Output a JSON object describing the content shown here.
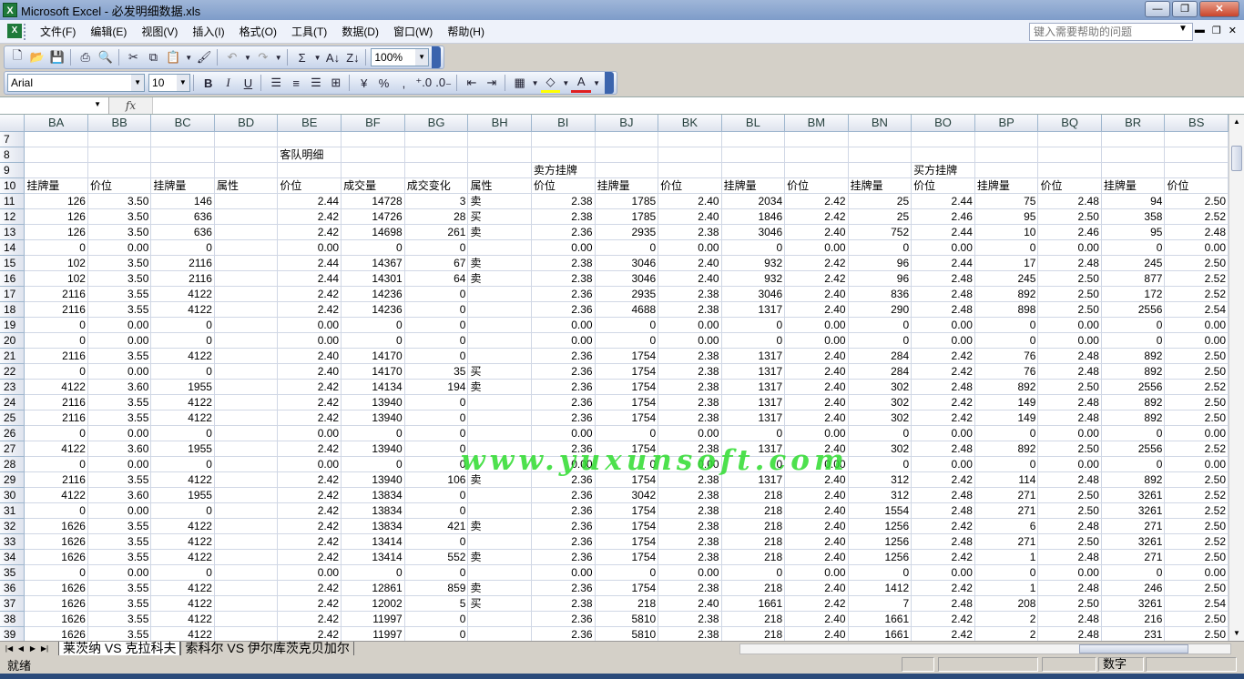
{
  "window": {
    "title": "Microsoft Excel - 必发明细数据.xls",
    "minimize": "—",
    "maximize": "❐",
    "close": "✕"
  },
  "menu": [
    "文件(F)",
    "编辑(E)",
    "视图(V)",
    "插入(I)",
    "格式(O)",
    "工具(T)",
    "数据(D)",
    "窗口(W)",
    "帮助(H)"
  ],
  "help_placeholder": "键入需要帮助的问题",
  "toolbar": {
    "zoom": "100%",
    "font": "Arial",
    "size": "10",
    "bold": "B",
    "italic": "I",
    "underline": "U",
    "sum": "Σ",
    "percent": "%"
  },
  "formula": {
    "fx": "fx",
    "name": "",
    "content": ""
  },
  "columns": [
    "BA",
    "BB",
    "BC",
    "BD",
    "BE",
    "BF",
    "BG",
    "BH",
    "BI",
    "BJ",
    "BK",
    "BL",
    "BM",
    "BN",
    "BO",
    "BP",
    "BQ",
    "BR",
    "BS"
  ],
  "rows": [
    {
      "n": "7",
      "c": [
        "",
        "",
        "",
        "",
        "",
        "",
        "",
        "",
        "",
        "",
        "",
        "",
        "",
        "",
        "",
        "",
        "",
        "",
        ""
      ]
    },
    {
      "n": "8",
      "c": [
        "",
        "",
        "",
        "",
        "客队明细",
        "",
        "",
        "",
        "",
        "",
        "",
        "",
        "",
        "",
        "",
        "",
        "",
        "",
        ""
      ]
    },
    {
      "n": "9",
      "c": [
        "",
        "",
        "",
        "",
        "",
        "",
        "",
        "",
        "卖方挂牌",
        "",
        "",
        "",
        "",
        "",
        "买方挂牌",
        "",
        "",
        "",
        ""
      ]
    },
    {
      "n": "10",
      "c": [
        "挂牌量",
        "价位",
        "挂牌量",
        "属性",
        "价位",
        "成交量",
        "成交变化",
        "属性",
        "价位",
        "挂牌量",
        "价位",
        "挂牌量",
        "价位",
        "挂牌量",
        "价位",
        "挂牌量",
        "价位",
        "挂牌量",
        "价位"
      ]
    },
    {
      "n": "11",
      "c": [
        "126",
        "3.50",
        "146",
        "",
        "2.44",
        "14728",
        "3",
        "卖",
        "2.38",
        "1785",
        "2.40",
        "2034",
        "2.42",
        "25",
        "2.44",
        "75",
        "2.48",
        "94",
        "2.50"
      ]
    },
    {
      "n": "12",
      "c": [
        "126",
        "3.50",
        "636",
        "",
        "2.42",
        "14726",
        "28",
        "买",
        "2.38",
        "1785",
        "2.40",
        "1846",
        "2.42",
        "25",
        "2.46",
        "95",
        "2.50",
        "358",
        "2.52"
      ]
    },
    {
      "n": "13",
      "c": [
        "126",
        "3.50",
        "636",
        "",
        "2.42",
        "14698",
        "261",
        "卖",
        "2.36",
        "2935",
        "2.38",
        "3046",
        "2.40",
        "752",
        "2.44",
        "10",
        "2.46",
        "95",
        "2.48"
      ]
    },
    {
      "n": "14",
      "c": [
        "0",
        "0.00",
        "0",
        "",
        "0.00",
        "0",
        "0",
        "",
        "0.00",
        "0",
        "0.00",
        "0",
        "0.00",
        "0",
        "0.00",
        "0",
        "0.00",
        "0",
        "0.00"
      ]
    },
    {
      "n": "15",
      "c": [
        "102",
        "3.50",
        "2116",
        "",
        "2.44",
        "14367",
        "67",
        "卖",
        "2.38",
        "3046",
        "2.40",
        "932",
        "2.42",
        "96",
        "2.44",
        "17",
        "2.48",
        "245",
        "2.50"
      ]
    },
    {
      "n": "16",
      "c": [
        "102",
        "3.50",
        "2116",
        "",
        "2.44",
        "14301",
        "64",
        "卖",
        "2.38",
        "3046",
        "2.40",
        "932",
        "2.42",
        "96",
        "2.48",
        "245",
        "2.50",
        "877",
        "2.52"
      ]
    },
    {
      "n": "17",
      "c": [
        "2116",
        "3.55",
        "4122",
        "",
        "2.42",
        "14236",
        "0",
        "",
        "2.36",
        "2935",
        "2.38",
        "3046",
        "2.40",
        "836",
        "2.48",
        "892",
        "2.50",
        "172",
        "2.52"
      ]
    },
    {
      "n": "18",
      "c": [
        "2116",
        "3.55",
        "4122",
        "",
        "2.42",
        "14236",
        "0",
        "",
        "2.36",
        "4688",
        "2.38",
        "1317",
        "2.40",
        "290",
        "2.48",
        "898",
        "2.50",
        "2556",
        "2.54"
      ]
    },
    {
      "n": "19",
      "c": [
        "0",
        "0.00",
        "0",
        "",
        "0.00",
        "0",
        "0",
        "",
        "0.00",
        "0",
        "0.00",
        "0",
        "0.00",
        "0",
        "0.00",
        "0",
        "0.00",
        "0",
        "0.00"
      ]
    },
    {
      "n": "20",
      "c": [
        "0",
        "0.00",
        "0",
        "",
        "0.00",
        "0",
        "0",
        "",
        "0.00",
        "0",
        "0.00",
        "0",
        "0.00",
        "0",
        "0.00",
        "0",
        "0.00",
        "0",
        "0.00"
      ]
    },
    {
      "n": "21",
      "c": [
        "2116",
        "3.55",
        "4122",
        "",
        "2.40",
        "14170",
        "0",
        "",
        "2.36",
        "1754",
        "2.38",
        "1317",
        "2.40",
        "284",
        "2.42",
        "76",
        "2.48",
        "892",
        "2.50"
      ]
    },
    {
      "n": "22",
      "c": [
        "0",
        "0.00",
        "0",
        "",
        "2.40",
        "14170",
        "35",
        "买",
        "2.36",
        "1754",
        "2.38",
        "1317",
        "2.40",
        "284",
        "2.42",
        "76",
        "2.48",
        "892",
        "2.50"
      ]
    },
    {
      "n": "23",
      "c": [
        "4122",
        "3.60",
        "1955",
        "",
        "2.42",
        "14134",
        "194",
        "卖",
        "2.36",
        "1754",
        "2.38",
        "1317",
        "2.40",
        "302",
        "2.48",
        "892",
        "2.50",
        "2556",
        "2.52"
      ]
    },
    {
      "n": "24",
      "c": [
        "2116",
        "3.55",
        "4122",
        "",
        "2.42",
        "13940",
        "0",
        "",
        "2.36",
        "1754",
        "2.38",
        "1317",
        "2.40",
        "302",
        "2.42",
        "149",
        "2.48",
        "892",
        "2.50"
      ]
    },
    {
      "n": "25",
      "c": [
        "2116",
        "3.55",
        "4122",
        "",
        "2.42",
        "13940",
        "0",
        "",
        "2.36",
        "1754",
        "2.38",
        "1317",
        "2.40",
        "302",
        "2.42",
        "149",
        "2.48",
        "892",
        "2.50"
      ]
    },
    {
      "n": "26",
      "c": [
        "0",
        "0.00",
        "0",
        "",
        "0.00",
        "0",
        "0",
        "",
        "0.00",
        "0",
        "0.00",
        "0",
        "0.00",
        "0",
        "0.00",
        "0",
        "0.00",
        "0",
        "0.00"
      ]
    },
    {
      "n": "27",
      "c": [
        "4122",
        "3.60",
        "1955",
        "",
        "2.42",
        "13940",
        "0",
        "",
        "2.36",
        "1754",
        "2.38",
        "1317",
        "2.40",
        "302",
        "2.48",
        "892",
        "2.50",
        "2556",
        "2.52"
      ]
    },
    {
      "n": "28",
      "c": [
        "0",
        "0.00",
        "0",
        "",
        "0.00",
        "0",
        "0",
        "",
        "0.00",
        "0",
        "0.00",
        "0",
        "0.00",
        "0",
        "0.00",
        "0",
        "0.00",
        "0",
        "0.00"
      ]
    },
    {
      "n": "29",
      "c": [
        "2116",
        "3.55",
        "4122",
        "",
        "2.42",
        "13940",
        "106",
        "卖",
        "2.36",
        "1754",
        "2.38",
        "1317",
        "2.40",
        "312",
        "2.42",
        "114",
        "2.48",
        "892",
        "2.50"
      ]
    },
    {
      "n": "30",
      "c": [
        "4122",
        "3.60",
        "1955",
        "",
        "2.42",
        "13834",
        "0",
        "",
        "2.36",
        "3042",
        "2.38",
        "218",
        "2.40",
        "312",
        "2.48",
        "271",
        "2.50",
        "3261",
        "2.52"
      ]
    },
    {
      "n": "31",
      "c": [
        "0",
        "0.00",
        "0",
        "",
        "2.42",
        "13834",
        "0",
        "",
        "2.36",
        "1754",
        "2.38",
        "218",
        "2.40",
        "1554",
        "2.48",
        "271",
        "2.50",
        "3261",
        "2.52"
      ]
    },
    {
      "n": "32",
      "c": [
        "1626",
        "3.55",
        "4122",
        "",
        "2.42",
        "13834",
        "421",
        "卖",
        "2.36",
        "1754",
        "2.38",
        "218",
        "2.40",
        "1256",
        "2.42",
        "6",
        "2.48",
        "271",
        "2.50"
      ]
    },
    {
      "n": "33",
      "c": [
        "1626",
        "3.55",
        "4122",
        "",
        "2.42",
        "13414",
        "0",
        "",
        "2.36",
        "1754",
        "2.38",
        "218",
        "2.40",
        "1256",
        "2.48",
        "271",
        "2.50",
        "3261",
        "2.52"
      ]
    },
    {
      "n": "34",
      "c": [
        "1626",
        "3.55",
        "4122",
        "",
        "2.42",
        "13414",
        "552",
        "卖",
        "2.36",
        "1754",
        "2.38",
        "218",
        "2.40",
        "1256",
        "2.42",
        "1",
        "2.48",
        "271",
        "2.50"
      ]
    },
    {
      "n": "35",
      "c": [
        "0",
        "0.00",
        "0",
        "",
        "0.00",
        "0",
        "0",
        "",
        "0.00",
        "0",
        "0.00",
        "0",
        "0.00",
        "0",
        "0.00",
        "0",
        "0.00",
        "0",
        "0.00"
      ]
    },
    {
      "n": "36",
      "c": [
        "1626",
        "3.55",
        "4122",
        "",
        "2.42",
        "12861",
        "859",
        "卖",
        "2.36",
        "1754",
        "2.38",
        "218",
        "2.40",
        "1412",
        "2.42",
        "1",
        "2.48",
        "246",
        "2.50"
      ]
    },
    {
      "n": "37",
      "c": [
        "1626",
        "3.55",
        "4122",
        "",
        "2.42",
        "12002",
        "5",
        "买",
        "2.38",
        "218",
        "2.40",
        "1661",
        "2.42",
        "7",
        "2.48",
        "208",
        "2.50",
        "3261",
        "2.54"
      ]
    },
    {
      "n": "38",
      "c": [
        "1626",
        "3.55",
        "4122",
        "",
        "2.42",
        "11997",
        "0",
        "",
        "2.36",
        "5810",
        "2.38",
        "218",
        "2.40",
        "1661",
        "2.42",
        "2",
        "2.48",
        "216",
        "2.50"
      ]
    },
    {
      "n": "39",
      "c": [
        "1626",
        "3.55",
        "4122",
        "",
        "2.42",
        "11997",
        "0",
        "",
        "2.36",
        "5810",
        "2.38",
        "218",
        "2.40",
        "1661",
        "2.42",
        "2",
        "2.48",
        "231",
        "2.50"
      ]
    }
  ],
  "watermark": "www.yuxunsoft.com",
  "sheet_tabs": {
    "active": "莱茨纳 VS 克拉科夫",
    "inactive": "索科尔 VS 伊尔库茨克贝加尔"
  },
  "status": {
    "ready": "就绪",
    "mode": "数字"
  }
}
